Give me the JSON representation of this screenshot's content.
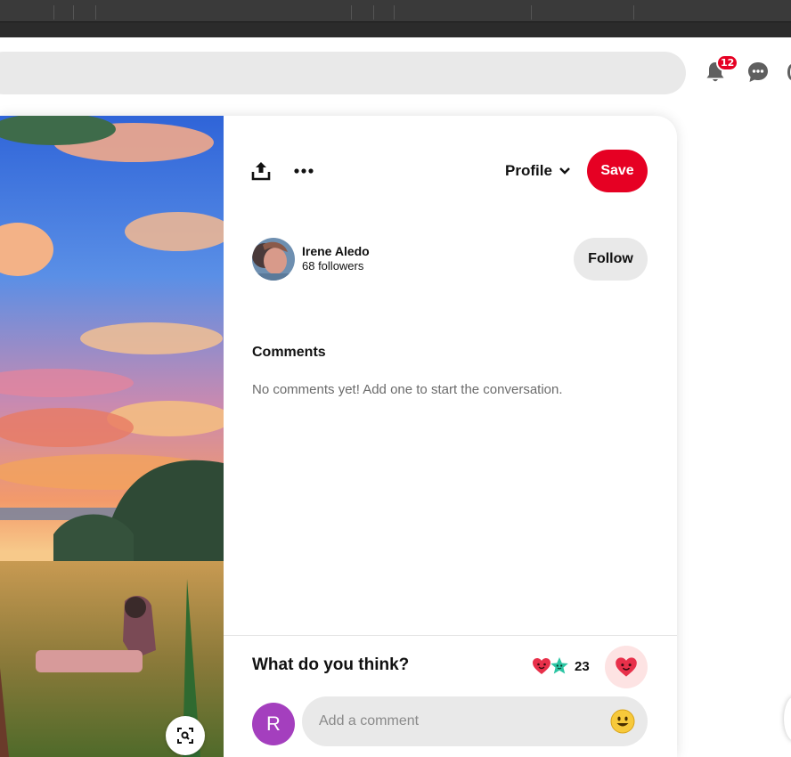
{
  "header": {
    "notifications": {
      "icon": "bell-icon",
      "count": "12"
    },
    "messages": {
      "icon": "chat-bubble-icon"
    }
  },
  "pin": {
    "image": "anime-style sunset landscape with girl sitting in meadow",
    "toolbar": {
      "share_icon": "upload-share-icon",
      "more_icon": "more-options-icon",
      "profile_label": "Profile",
      "save_label": "Save"
    },
    "author": {
      "name": "Irene Aledo",
      "followers": "68 followers",
      "follow_label": "Follow"
    },
    "comments": {
      "title": "Comments",
      "empty_text": "No comments yet! Add one to start the conversation."
    },
    "feedback": {
      "prompt": "What do you think?",
      "reaction_count": "23",
      "reaction_icons": [
        "heart-face-icon",
        "star-face-icon"
      ]
    },
    "composer": {
      "user_initial": "R",
      "placeholder": "Add a comment",
      "emoji_icon": "smiley-emoji-icon"
    }
  },
  "colors": {
    "brand_red": "#e60023",
    "user_avatar": "#a43fbe",
    "reaction_bg": "#fde3e3"
  }
}
